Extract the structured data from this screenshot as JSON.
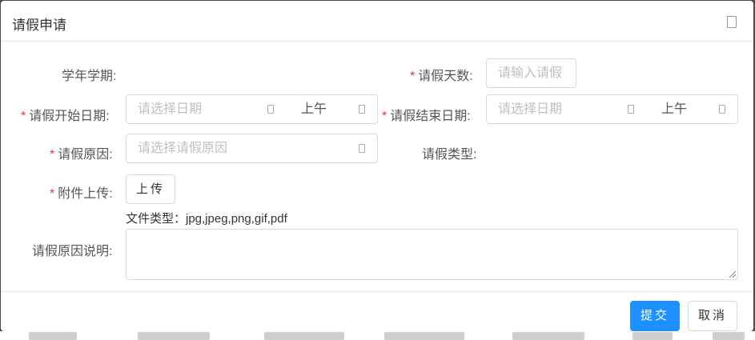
{
  "dialog": {
    "title": "请假申请",
    "close_icon": "close-icon"
  },
  "form": {
    "term_label": "学年学期:",
    "days_label": "请假天数:",
    "days_placeholder": "请输入请假",
    "start_label": "请假开始日期:",
    "start_date_placeholder": "请选择日期",
    "start_half": "上午",
    "end_label": "请假结束日期:",
    "end_date_placeholder": "请选择日期",
    "end_half": "上午",
    "reason_label": "请假原因:",
    "reason_placeholder": "请选择请假原因",
    "type_label": "请假类型:",
    "attach_label": "附件上传:",
    "upload_button": "上传",
    "file_types_hint": "文件类型：jpg,jpeg,png,gif,pdf",
    "desc_label": "请假原因说明:",
    "required_mark": "*"
  },
  "footer": {
    "submit": "提交",
    "cancel": "取消"
  },
  "colors": {
    "primary": "#1e90ff",
    "required": "#e0393e"
  }
}
